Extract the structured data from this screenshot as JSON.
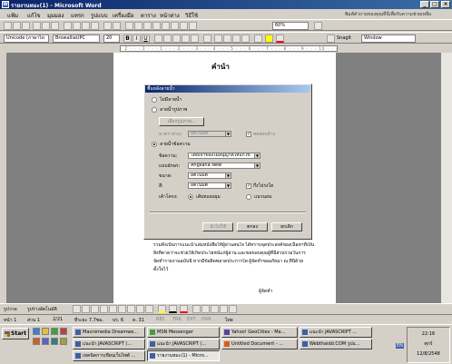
{
  "window": {
    "title": "รายงานหมะ(1) - Microsoft Word",
    "min": "_",
    "max": "□",
    "close": "×"
  },
  "menu": [
    "แฟ้ม",
    "แก้ไข",
    "มุมมอง",
    "แทรก",
    "รูปแบบ",
    "เครื่องมือ",
    "ตาราง",
    "หน้าต่าง",
    "วิธีใช้"
  ],
  "help_box": "พิมพ์คำถามของคุณที่นี่เพื่อรับความช่วยเหลือ",
  "standard_toolbar": {
    "zoom": "60%"
  },
  "format_toolbar": {
    "style": "Unicode (ภาษาไท",
    "font": "BrowalliaUPC",
    "size": "20",
    "bold": "B",
    "italic": "I",
    "underline": "U",
    "snagit": "SnagIt",
    "window_combo": "Window"
  },
  "ruler_marks": "· 2 · · · 1 · · · 1 · · · 2 · · · 3 · · · 4 · · · 5 · · · 6 · · · 7 · · · 8 · · · 9 · · · 10 · · · 11 · · · 12 · · · 13 · · · 14",
  "document": {
    "heading": "คำนำ",
    "body_lines": [
      "รวมทั้งเป็นการแนะนำเล่มหนังสือให้ผู้อ่านสนใจ ได้ทราบจุดประสงค์ของเนื้อหาที่เป็น",
      "สิ่งที่คาดว่าจะช่วยให้เกิดประโยชน์แก่ผู้อ่าน และขอขอบคุณผู้ที่มีส่วนร่วมในการ",
      "จัดทำรายงานฉบับนี้ หากมีข้อผิดพลาดประการใด ผู้จัดทำขออภัยมา ณ ที่นี้ด้วย",
      "ตั้งใจไว้"
    ],
    "signature": "ผู้จัดทำ"
  },
  "dialog": {
    "title": "พื้นหลังลายน้ำ",
    "no_watermark": "ไม่มีลายน้ำ",
    "picture_watermark": "ลายน้ำรูปภาพ",
    "select_picture": "เลือกรูปภาพ...",
    "scale_label": "มาตราส่วน:",
    "scale_value": "อัตโนมัติ",
    "washout": "ทดสอบล้าง",
    "text_watermark": "ลายน้ำข้อความ",
    "text_label": "ข้อความ:",
    "text_value": "โดยเจ้าของไม่อนุญาตให้แก้ไข",
    "font_label": "แบบอักษร:",
    "font_value": "Angsana New",
    "size_label": "ขนาด:",
    "size_value": "อัตโนมัติ",
    "color_label": "สี:",
    "color_value": "อัตโนมัติ",
    "semitransparent": "กึ่งโปร่งใส",
    "layout_label": "เค้าโครง:",
    "diagonal": "เส้นทแยงมุม",
    "horizontal": "แนวนอน",
    "apply": "นำไปใช้",
    "ok": "ตกลง",
    "cancel": "ยกเลิก"
  },
  "draw_toolbar": {
    "draw": "รูปวาด",
    "autoshapes": "รูปร่างอัตโนมัติ"
  },
  "status_bar": {
    "page": "หน้า 1",
    "section": "ส่วน 1",
    "pages": "2/21",
    "at": "ที่ระยะ 7.7ซม.",
    "line": "บร. 6",
    "col": "ค. 31",
    "rec": "REC",
    "trk": "TRK",
    "ext": "EXT",
    "ovr": "OVR",
    "lang": "ไทย"
  },
  "taskbar": {
    "start": "Start",
    "row1": [
      "Macromedia Dreamwe...",
      "MSN Messenger",
      "Yahoo! GeoCities - Ma...",
      "แนะนำ JAVASCRIPT ..."
    ],
    "row2": [
      "แนะนำ JAVASCRIPT (...",
      "แนะนำ JAVASCRIPT (...",
      "Untitled Document - ...",
      "Webthaidd.COM รูปแ..."
    ],
    "row3": [
      "เทคนิคการเขียนเว็บไซต์ ...",
      "รายงานหมะ(1) - Micro..."
    ],
    "lang": "EN",
    "time": "22:16",
    "day": "ศุกร์",
    "date": "12/8/2548"
  },
  "colors": {
    "titlebar": "#0a246a",
    "face": "#d4d0c8"
  }
}
